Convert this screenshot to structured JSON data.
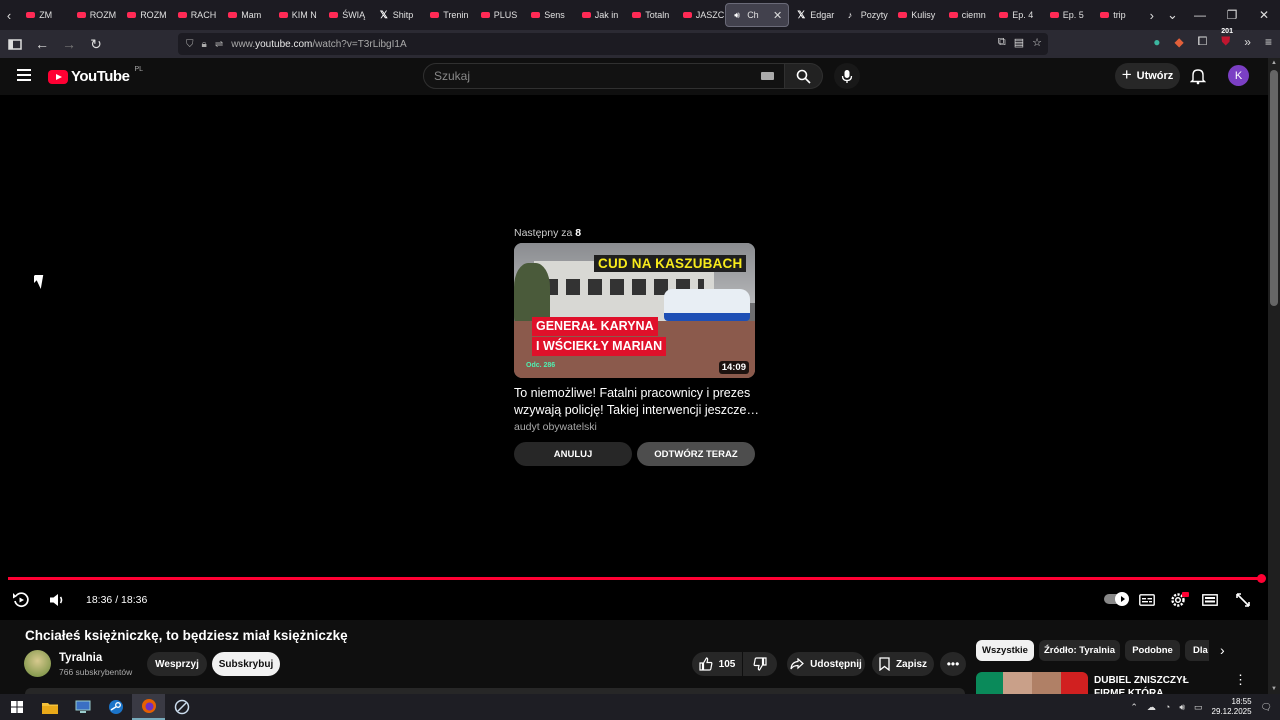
{
  "browser": {
    "tabs": [
      {
        "label": "ZM",
        "icon": "youtube-icon"
      },
      {
        "label": "ROZM",
        "icon": "youtube-icon"
      },
      {
        "label": "ROZM",
        "icon": "youtube-icon"
      },
      {
        "label": "RACH",
        "icon": "youtube-icon"
      },
      {
        "label": "Mam",
        "icon": "youtube-icon"
      },
      {
        "label": "KIM N",
        "icon": "youtube-icon"
      },
      {
        "label": "ŚWIĄ",
        "icon": "youtube-icon"
      },
      {
        "label": "Shitp",
        "icon": "x-icon"
      },
      {
        "label": "Trenin",
        "icon": "youtube-icon"
      },
      {
        "label": "PLUS",
        "icon": "youtube-icon"
      },
      {
        "label": "Sens",
        "icon": "youtube-icon"
      },
      {
        "label": "Jak in",
        "icon": "youtube-icon"
      },
      {
        "label": "Totaln",
        "icon": "youtube-icon"
      },
      {
        "label": "JASZC",
        "icon": "youtube-icon"
      },
      {
        "label": "Ch",
        "icon": "speaker-icon",
        "active": true
      },
      {
        "label": "Edgar",
        "icon": "x-icon"
      },
      {
        "label": "Pozyty",
        "icon": "tiktok-icon"
      },
      {
        "label": "Kulisy",
        "icon": "youtube-icon"
      },
      {
        "label": "ciemn",
        "icon": "youtube-icon"
      },
      {
        "label": "Ep. 4",
        "icon": "youtube-icon"
      },
      {
        "label": "Ep. 5",
        "icon": "youtube-icon"
      },
      {
        "label": "trip",
        "icon": "youtube-icon"
      }
    ],
    "url_prefix": "www.",
    "url_host": "youtube.com",
    "url_path": "/watch?v=T3rLibgI1A",
    "extension_badge": "201"
  },
  "youtube": {
    "logo_text": "YouTube",
    "country_code": "PL",
    "search_placeholder": "Szukaj",
    "create_label": "Utwórz",
    "avatar_letter": "K",
    "accent": "#ff0033"
  },
  "player": {
    "upnext_prefix": "Następny za",
    "upnext_seconds": "8",
    "thumb_title": "CUD NA KASZUBACH",
    "thumb_sub_line1": "GENERAŁ KARYNA",
    "thumb_sub_line2": "I WŚCIEKŁY MARIAN",
    "thumb_episode": "Odc. 286",
    "thumb_duration": "14:09",
    "next_title": "To niemożliwe! Fatalni pracownicy i prezes wzywają policję! Takiej interwencji jeszcze…",
    "next_channel": "audyt obywatelski",
    "cancel_label": "ANULUJ",
    "play_now_label": "ODTWÓRZ TERAZ",
    "time_display": "18:36 / 18:36",
    "progress_fraction": 1.0
  },
  "video": {
    "title": "Chciałeś księżniczkę, to będziesz miał księżniczkę",
    "channel_name": "Tyralnia",
    "subscribers": "766 subskrybentów",
    "support_label": "Wesprzyj",
    "subscribe_label": "Subskrybuj",
    "likes": "105",
    "share_label": "Udostępnij",
    "save_label": "Zapisz"
  },
  "chips": [
    {
      "label": "Wszystkie",
      "active": true
    },
    {
      "label": "Źródło: Tyralnia"
    },
    {
      "label": "Podobne"
    },
    {
      "label": "Dla"
    }
  ],
  "recommended": {
    "title": "DUBIEL ZNISZCZYŁ FIRMĘ KTÓRA ZABEKLAMOWAŁ..."
  },
  "taskbar": {
    "time": "18:55",
    "date": "29.12.2025"
  }
}
